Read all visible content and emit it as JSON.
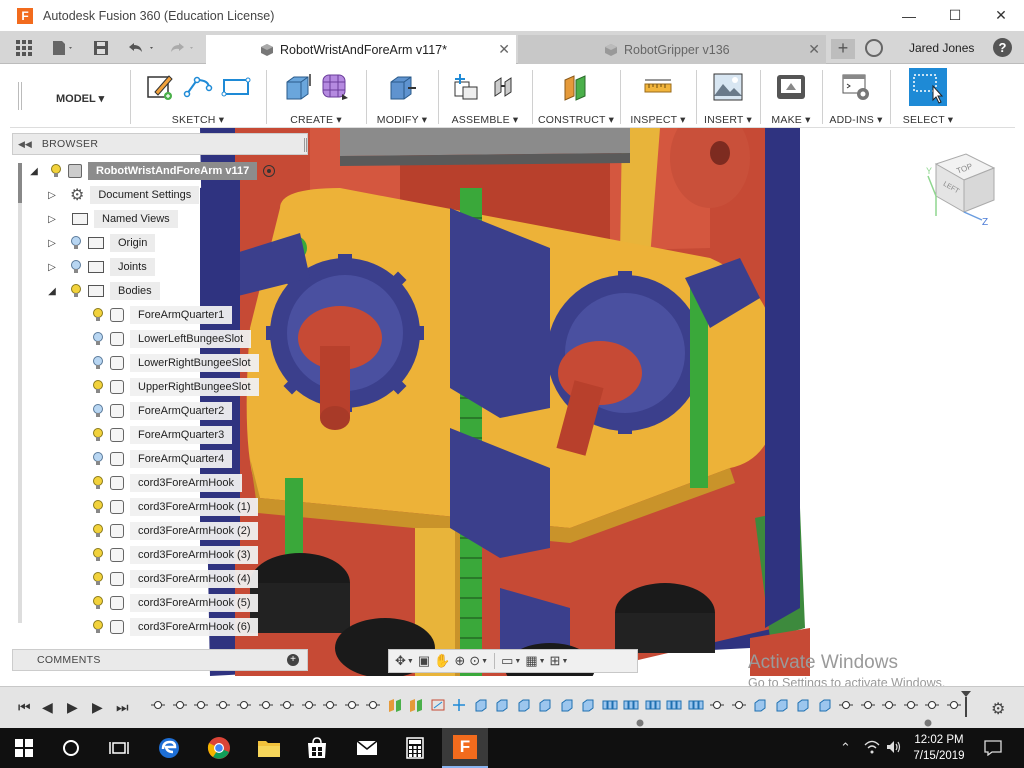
{
  "window": {
    "title": "Autodesk Fusion 360 (Education License)",
    "app_icon_letter": "F",
    "controls": [
      "—",
      "☐",
      "✕"
    ]
  },
  "tabs": [
    {
      "label": "RobotWristAndForeArm v117*",
      "active": true
    },
    {
      "label": "RobotGripper v136",
      "active": false
    }
  ],
  "user": {
    "name": "Jared Jones"
  },
  "toolbar": {
    "workspace": "MODEL ▾",
    "groups": [
      {
        "label": "SKETCH ▾"
      },
      {
        "label": "CREATE ▾"
      },
      {
        "label": "MODIFY ▾"
      },
      {
        "label": "ASSEMBLE ▾"
      },
      {
        "label": "CONSTRUCT ▾"
      },
      {
        "label": "INSPECT ▾"
      },
      {
        "label": "INSERT ▾"
      },
      {
        "label": "MAKE ▾"
      },
      {
        "label": "ADD-INS ▾"
      },
      {
        "label": "SELECT ▾"
      }
    ]
  },
  "browser": {
    "title": "BROWSER",
    "root": "RobotWristAndForeArm v117",
    "nodes": [
      {
        "label": "Document Settings"
      },
      {
        "label": "Named Views"
      },
      {
        "label": "Origin"
      },
      {
        "label": "Joints"
      },
      {
        "label": "Bodies"
      }
    ],
    "bodies": [
      "ForeArmQuarter1",
      "LowerLeftBungeeSlot",
      "LowerRightBungeeSlot",
      "UpperRightBungeeSlot",
      "ForeArmQuarter2",
      "ForeArmQuarter3",
      "ForeArmQuarter4",
      "cord3ForeArmHook",
      "cord3ForeArmHook (1)",
      "cord3ForeArmHook (2)",
      "cord3ForeArmHook (3)",
      "cord3ForeArmHook (4)",
      "cord3ForeArmHook (5)",
      "cord3ForeArmHook (6)"
    ]
  },
  "comments": {
    "title": "COMMENTS"
  },
  "viewcube": {
    "top": "TOP",
    "left": "LEFT",
    "axis_z": "Z",
    "axis_y": "Y"
  },
  "watermark": {
    "line1": "Activate Windows",
    "line2": "Go to Settings to activate Windows."
  },
  "taskbar": {
    "time": "12:02 PM",
    "date": "7/15/2019"
  },
  "colors": {
    "accent_blue": "#1e8ad6",
    "fusion_orange": "#f26b1d",
    "gear_navy": "#3b3f8c",
    "body_red": "#d2452f",
    "plate_yellow": "#f0b63c",
    "pin_green": "#3aa83a"
  }
}
